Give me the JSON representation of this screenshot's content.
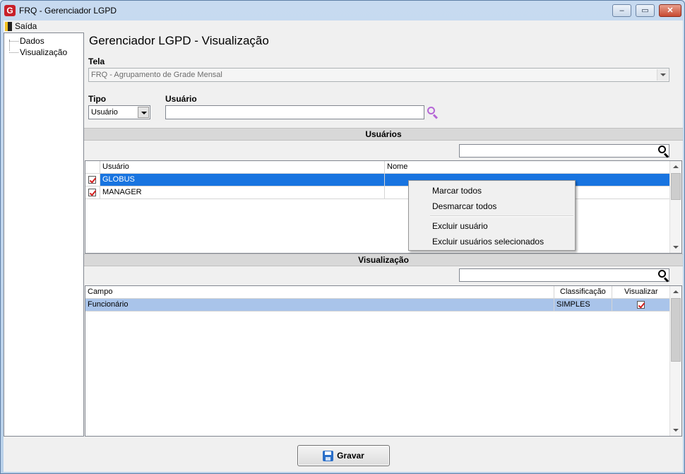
{
  "window": {
    "title": "FRQ - Gerenciador LGPD",
    "app_icon_letter": "G",
    "minimize_glyph": "–",
    "maximize_glyph": "▭",
    "close_glyph": "✕"
  },
  "menu": {
    "exit_label": "Saída"
  },
  "tree": {
    "items": [
      "Dados",
      "Visualização"
    ]
  },
  "main": {
    "title": "Gerenciador LGPD - Visualização",
    "tela_label": "Tela",
    "tela_value": "FRQ - Agrupamento de Grade Mensal",
    "tipo_label": "Tipo",
    "tipo_value": "Usuário",
    "usuario_label": "Usuário",
    "usuario_value": ""
  },
  "users_section": {
    "header": "Usuários",
    "search_value": "",
    "columns": [
      "Usuário",
      "Nome"
    ],
    "rows": [
      {
        "checked": true,
        "usuario": "GLOBUS",
        "nome": "",
        "selected": true
      },
      {
        "checked": true,
        "usuario": "MANAGER",
        "nome": "",
        "selected": false
      }
    ]
  },
  "context_menu": {
    "items": [
      "Marcar todos",
      "Desmarcar todos",
      "Excluir usuário",
      "Excluir usuários selecionados"
    ]
  },
  "view_section": {
    "header": "Visualização",
    "search_value": "",
    "columns": [
      "Campo",
      "Classificação",
      "Visualizar"
    ],
    "rows": [
      {
        "campo": "Funcionário",
        "classificacao": "SIMPLES",
        "visualizar": true
      }
    ]
  },
  "footer": {
    "save_label": "Gravar"
  },
  "colors": {
    "selection_blue": "#1874e0",
    "row_highlight": "#a9c4ea",
    "search_icon_purple": "#b566d6",
    "check_red": "#d21e1e"
  }
}
